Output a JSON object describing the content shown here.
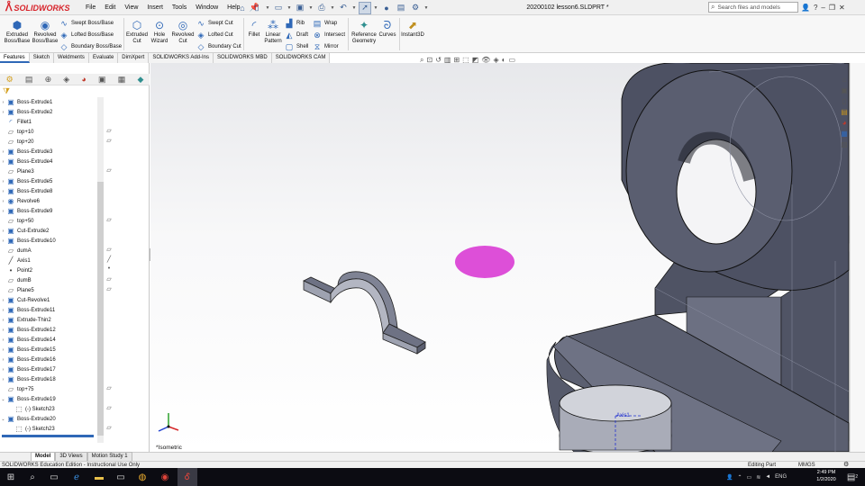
{
  "app": {
    "name": "SOLIDWORKS",
    "document_title": "20200102 lesson6.SLDPRT *",
    "search_placeholder": "Search files and models"
  },
  "menu": [
    "File",
    "Edit",
    "View",
    "Insert",
    "Tools",
    "Window",
    "Help"
  ],
  "ribbon": {
    "extruded_boss": "Extruded Boss/Base",
    "revolved_boss": "Revolved Boss/Base",
    "swept_boss": "Swept Boss/Base",
    "lofted_boss": "Lofted Boss/Base",
    "boundary_boss": "Boundary Boss/Base",
    "extruded_cut": "Extruded Cut",
    "hole_wizard": "Hole Wizard",
    "revolved_cut": "Revolved Cut",
    "swept_cut": "Swept Cut",
    "lofted_cut": "Lofted Cut",
    "boundary_cut": "Boundary Cut",
    "fillet": "Fillet",
    "linear_pattern": "Linear Pattern",
    "rib": "Rib",
    "draft": "Draft",
    "shell": "Shell",
    "wrap": "Wrap",
    "intersect": "Intersect",
    "mirror": "Mirror",
    "reference_geometry": "Reference Geometry",
    "curves": "Curves",
    "instant3d": "Instant3D"
  },
  "command_tabs": [
    "Features",
    "Sketch",
    "Weldments",
    "Evaluate",
    "DimXpert",
    "SOLIDWORKS Add-Ins",
    "SOLIDWORKS MBD",
    "SOLIDWORKS CAM"
  ],
  "active_tab": "Features",
  "feature_tree": [
    {
      "label": "Boss-Extrude1",
      "icon": "extrude-icon",
      "expandable": true
    },
    {
      "label": "Boss-Extrude2",
      "icon": "extrude-icon",
      "expandable": true
    },
    {
      "label": "Fillet1",
      "icon": "fillet-icon",
      "expandable": false
    },
    {
      "label": "top+10",
      "icon": "plane-icon",
      "expandable": false
    },
    {
      "label": "top+20",
      "icon": "plane-icon",
      "expandable": false
    },
    {
      "label": "Boss-Extrude3",
      "icon": "extrude-icon",
      "expandable": true
    },
    {
      "label": "Boss-Extrude4",
      "icon": "extrude-icon",
      "expandable": true
    },
    {
      "label": "Plane3",
      "icon": "plane-icon",
      "expandable": false
    },
    {
      "label": "Boss-Extrude5",
      "icon": "extrude-icon",
      "expandable": true
    },
    {
      "label": "Boss-Extrude8",
      "icon": "extrude-icon",
      "expandable": true
    },
    {
      "label": "Revolve6",
      "icon": "revolve-icon",
      "expandable": true
    },
    {
      "label": "Boss-Extrude9",
      "icon": "extrude-icon",
      "expandable": true
    },
    {
      "label": "top+50",
      "icon": "plane-icon",
      "expandable": false
    },
    {
      "label": "Cut-Extrude2",
      "icon": "cut-icon",
      "expandable": true
    },
    {
      "label": "Boss-Extrude10",
      "icon": "extrude-icon",
      "expandable": true
    },
    {
      "label": "dumA",
      "icon": "plane-icon",
      "expandable": false
    },
    {
      "label": "Axis1",
      "icon": "axis-icon",
      "expandable": false
    },
    {
      "label": "Point2",
      "icon": "point-icon",
      "expandable": false
    },
    {
      "label": "dumB",
      "icon": "plane-icon",
      "expandable": false
    },
    {
      "label": "Plane5",
      "icon": "plane-icon",
      "expandable": false
    },
    {
      "label": "Cut-Revolve1",
      "icon": "cut-icon",
      "expandable": true
    },
    {
      "label": "Boss-Extrude11",
      "icon": "extrude-icon",
      "expandable": true
    },
    {
      "label": "Extrude-Thin2",
      "icon": "extrude-icon",
      "expandable": true
    },
    {
      "label": "Boss-Extrude12",
      "icon": "extrude-icon",
      "expandable": true
    },
    {
      "label": "Boss-Extrude14",
      "icon": "extrude-icon",
      "expandable": true
    },
    {
      "label": "Boss-Extrude15",
      "icon": "extrude-icon",
      "expandable": true
    },
    {
      "label": "Boss-Extrude16",
      "icon": "extrude-icon",
      "expandable": true
    },
    {
      "label": "Boss-Extrude17",
      "icon": "extrude-icon",
      "expandable": true
    },
    {
      "label": "Boss-Extrude18",
      "icon": "extrude-icon",
      "expandable": true
    },
    {
      "label": "top+75",
      "icon": "plane-icon",
      "expandable": false
    },
    {
      "label": "Boss-Extrude19",
      "icon": "extrude-icon",
      "expandable": true,
      "expanded": true
    },
    {
      "label": "(-) Sketch23",
      "icon": "sketch-icon",
      "expandable": false,
      "child": true
    },
    {
      "label": "Boss-Extrude20",
      "icon": "extrude-icon",
      "expandable": true,
      "expanded": true
    },
    {
      "label": "(-) Sketch23",
      "icon": "sketch-icon",
      "expandable": false,
      "child": true
    }
  ],
  "viewport": {
    "view_orientation": "*Isometric",
    "axis_label": "Axis1"
  },
  "bottom_tabs": [
    "Model",
    "3D Views",
    "Motion Study 1"
  ],
  "active_bottom_tab": "Model",
  "status": {
    "left": "SOLIDWORKS Education Edition - Instructional Use Only",
    "mode": "Editing Part",
    "units": "MMGS"
  },
  "taskbar": {
    "time": "2:49 PM",
    "date": "1/2/2020",
    "language": "ENG",
    "notifications": "2"
  },
  "colors": {
    "accent": "#2f68b7",
    "solidworks_red": "#d8232a",
    "model_face": "#5b5f70",
    "selection_magenta": "#dd4fd8"
  }
}
